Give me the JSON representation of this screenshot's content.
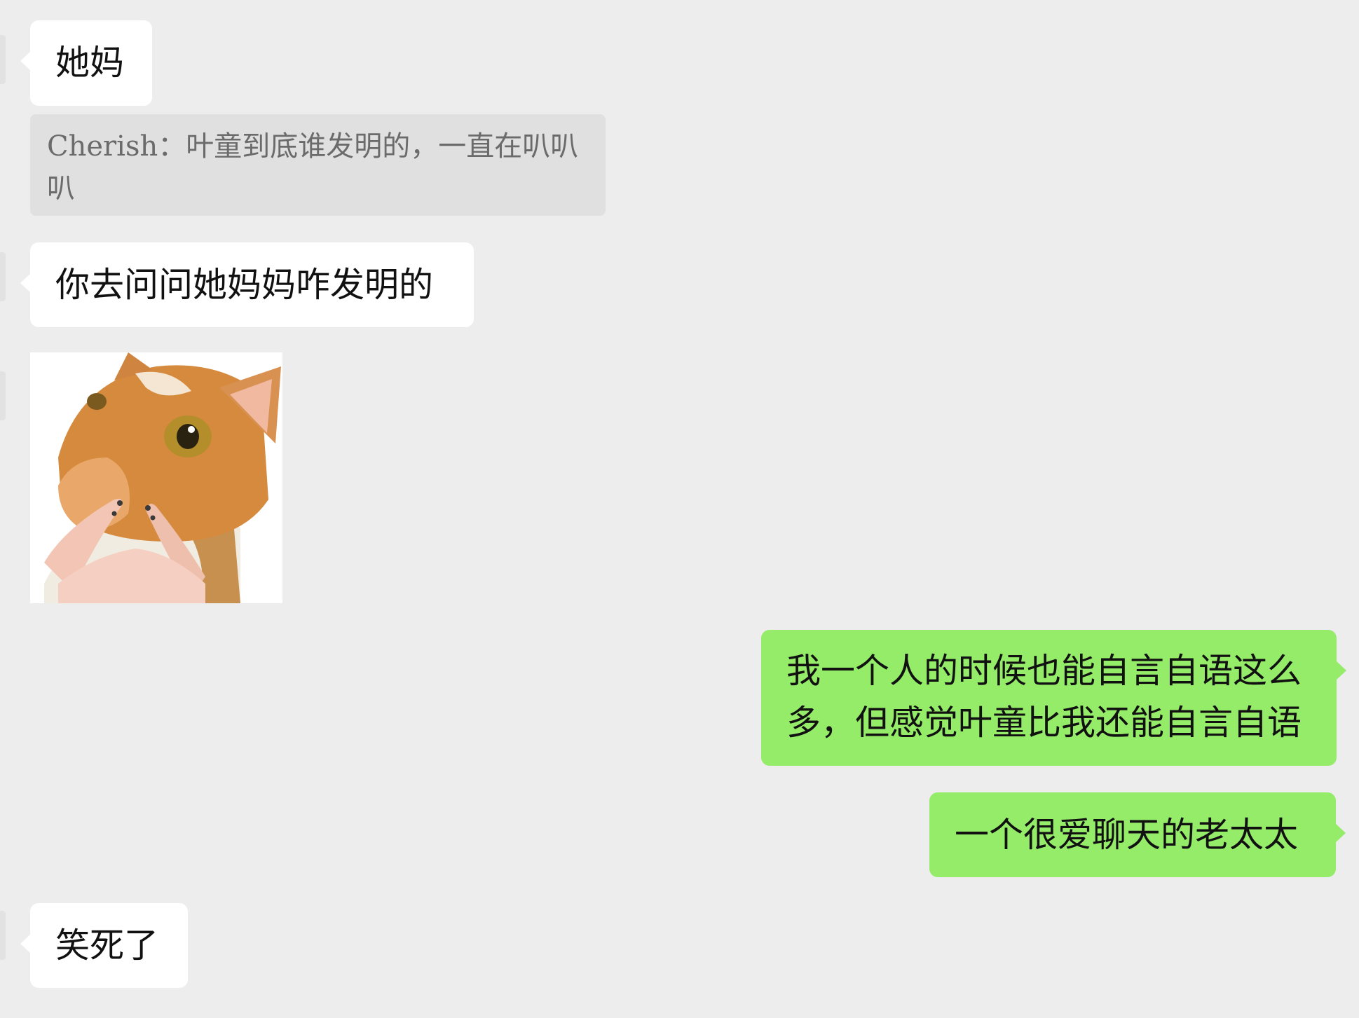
{
  "messages": {
    "m1": {
      "text": "她妈"
    },
    "quote": {
      "text": "Cherish：叶童到底谁发明的，一直在叭叭叭"
    },
    "m2": {
      "text": "你去问问她妈妈咋发明的"
    },
    "sticker": {
      "icon": "cat-with-hands-sticker"
    },
    "m3": {
      "text": "我一个人的时候也能自言自语这么多，但感觉叶童比我还能自言自语"
    },
    "m4": {
      "text": "一个很爱聊天的老太太"
    },
    "m5": {
      "text": "笑死了"
    }
  },
  "colors": {
    "background": "#ededed",
    "incoming_bubble": "#ffffff",
    "outgoing_bubble": "#95ec69",
    "quote_bg": "#e0e0e0",
    "quote_text": "#6b6b6b"
  }
}
